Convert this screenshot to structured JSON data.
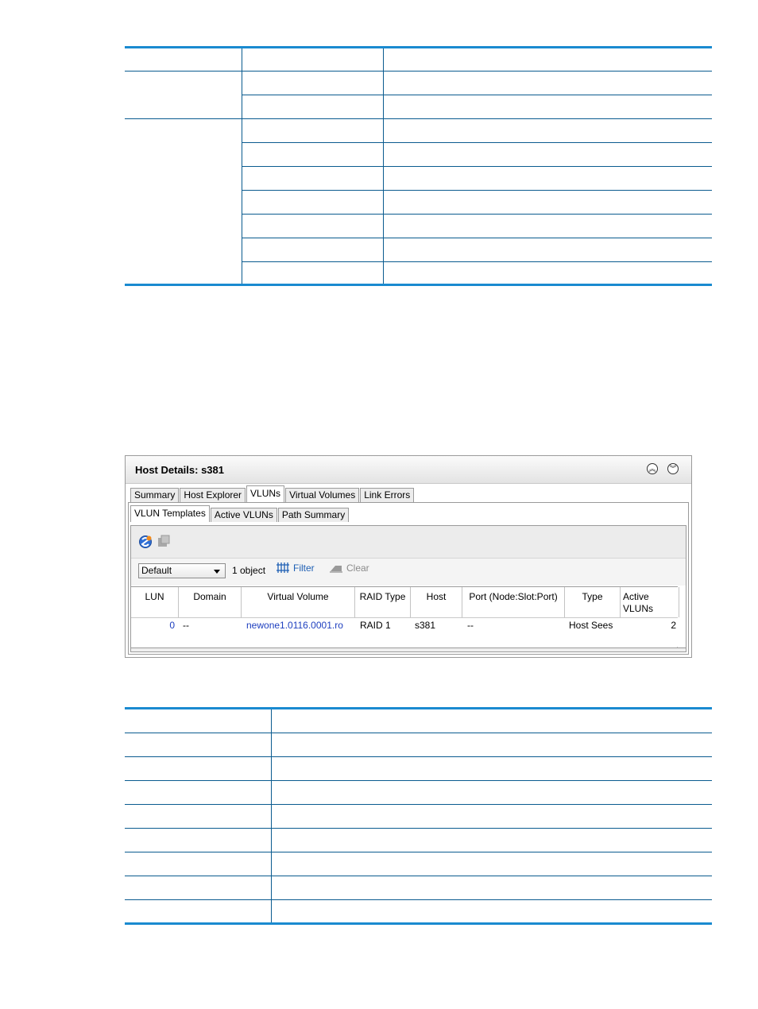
{
  "panel": {
    "title": "Host Details: s381",
    "collapse_icon": "double-chevron-up-icon",
    "expand_icon": "double-chevron-down-icon"
  },
  "main_tabs": [
    "Summary",
    "Host Explorer",
    "VLUNs",
    "Virtual Volumes",
    "Link Errors"
  ],
  "main_tab_active": "VLUNs",
  "sub_tabs": [
    "VLUN Templates",
    "Active VLUNs",
    "Path Summary"
  ],
  "sub_tab_active": "VLUN Templates",
  "toolbar": {
    "icons": [
      "create-vlun-icon",
      "remove-vlun-icon"
    ],
    "filter_select": "Default",
    "object_count": "1 object",
    "filter_label": "Filter",
    "clear_label": "Clear"
  },
  "grid": {
    "columns": [
      "LUN",
      "Domain",
      "Virtual Volume",
      "RAID Type",
      "Host",
      "Port (Node:Slot:Port)",
      "Type",
      "Active VLUNs"
    ],
    "rows": [
      [
        "0",
        "--",
        "newone1.0116.0001.ro",
        "RAID 1",
        "s381",
        "--",
        "Host Sees",
        "2"
      ]
    ]
  },
  "colors": {
    "table_rule": "#1a8ad0",
    "link": "#1e3fbf"
  }
}
